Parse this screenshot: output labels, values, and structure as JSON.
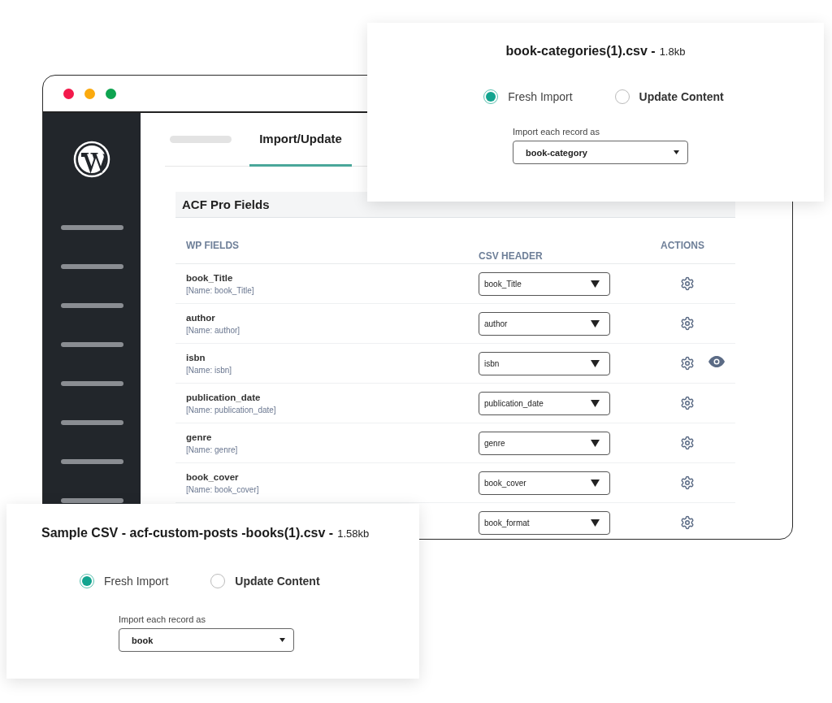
{
  "browser_window": {
    "tabs": [
      {
        "label": "Import/Update",
        "selected": true
      }
    ],
    "section_title": "ACF Pro Fields",
    "columns": [
      "WP FIELDS",
      "CSV HEADER",
      "ACTIONS"
    ],
    "rows": [
      {
        "field": "book_Title",
        "name": "[Name: book_Title]",
        "csv_header": "book_Title",
        "actions": [
          {
            "kind": "settings"
          }
        ]
      },
      {
        "field": "author",
        "name": "[Name: author]",
        "csv_header": "author",
        "actions": [
          {
            "kind": "settings"
          }
        ]
      },
      {
        "field": "isbn",
        "name": "[Name: isbn]",
        "csv_header": "isbn",
        "actions": [
          {
            "kind": "settings"
          },
          {
            "kind": "preview"
          }
        ]
      },
      {
        "field": "publication_date",
        "name": "[Name: publication_date]",
        "csv_header": "publication_date",
        "actions": [
          {
            "kind": "settings"
          }
        ]
      },
      {
        "field": "genre",
        "name": "[Name: genre]",
        "csv_header": "genre",
        "actions": [
          {
            "kind": "settings"
          }
        ]
      },
      {
        "field": "book_cover",
        "name": "[Name: book_cover]",
        "csv_header": "book_cover",
        "actions": [
          {
            "kind": "settings"
          }
        ]
      },
      {
        "csv_header": "book_format",
        "actions": [
          {
            "kind": "settings"
          }
        ]
      }
    ]
  },
  "import_cards": [
    {
      "title": "book-categories(1).csv -",
      "size": "1.8kb",
      "options": [
        {
          "label": "Fresh Import",
          "selected": true
        },
        {
          "label": "Update Content",
          "selected": false
        }
      ],
      "record_label": "Import each record as",
      "record_type": "book-category"
    },
    {
      "title": "Sample CSV - acf-custom-posts -books(1).csv -",
      "size": "1.58kb",
      "options": [
        {
          "label": "Fresh Import",
          "selected": true
        },
        {
          "label": "Update Content",
          "selected": false
        }
      ],
      "record_label": "Import each record as",
      "record_type": "book"
    }
  ]
}
